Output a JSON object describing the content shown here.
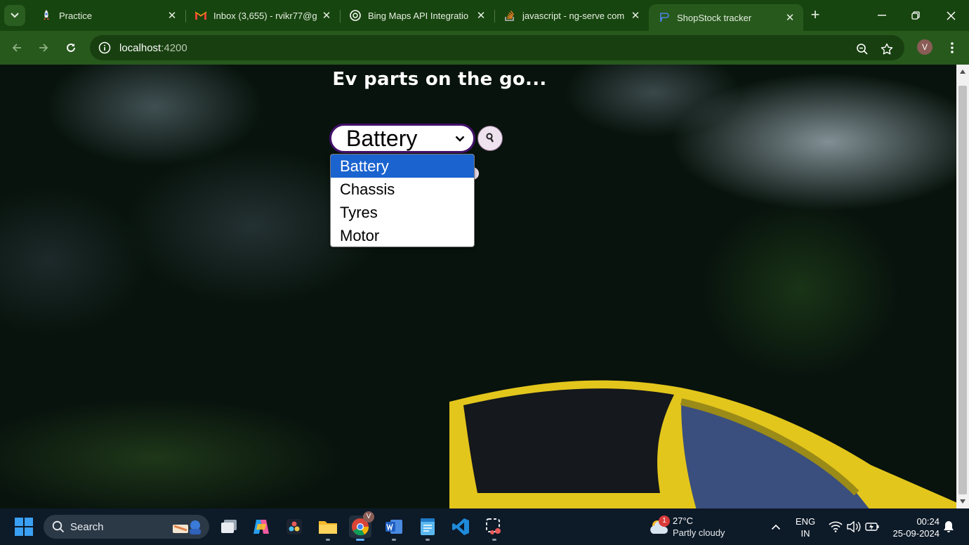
{
  "browser": {
    "tabs": [
      {
        "title": "Practice",
        "favicon": "rocket-icon",
        "active": false
      },
      {
        "title": "Inbox (3,655) - rvikr77@g",
        "favicon": "gmail-icon",
        "active": false
      },
      {
        "title": "Bing Maps API Integratio",
        "favicon": "openai-icon",
        "active": false
      },
      {
        "title": "javascript - ng-serve com",
        "favicon": "stackoverflow-icon",
        "active": false
      },
      {
        "title": "ShopStock tracker",
        "favicon": "app-icon",
        "active": true
      }
    ],
    "close_glyph": "✕",
    "new_tab_glyph": "+",
    "url_host": "localhost",
    "url_port": ":4200",
    "profile_initial": "V",
    "theme_color": "#27591c"
  },
  "page": {
    "heading": "Ev parts on the go...",
    "select": {
      "selected": "Battery",
      "options": [
        "Battery",
        "Chassis",
        "Tyres",
        "Motor"
      ],
      "highlighted_index": 0,
      "highlight_color": "#1b63cf"
    },
    "search_button_icon": "search-icon"
  },
  "taskbar": {
    "search_label": "Search",
    "weather": {
      "temp": "27°C",
      "condition": "Partly cloudy",
      "badge": "1"
    },
    "language": {
      "line1": "ENG",
      "line2": "IN"
    },
    "clock": {
      "time": "00:24",
      "date": "25-09-2024"
    },
    "chrome_badge": "V"
  }
}
